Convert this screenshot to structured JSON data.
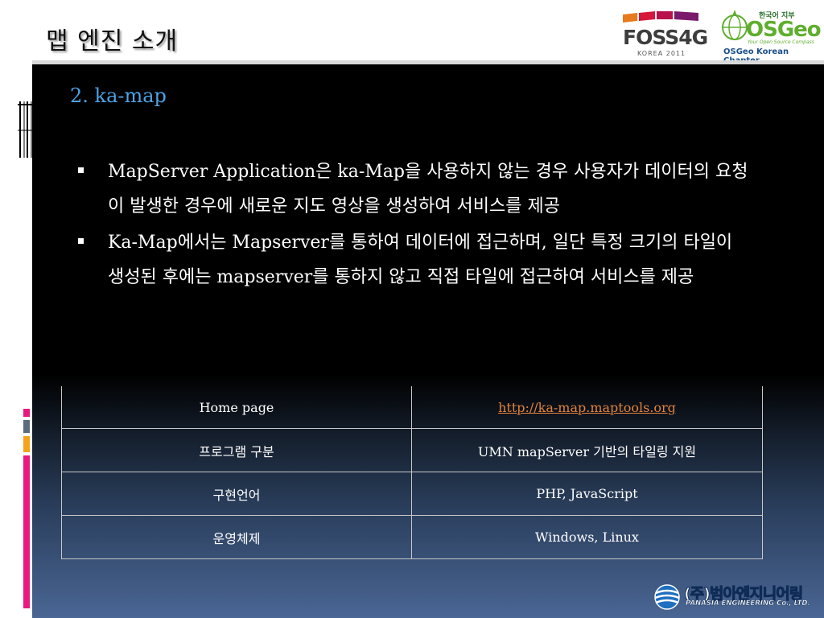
{
  "header": {
    "title": "맵 엔진 소개"
  },
  "logos": {
    "foss4g": {
      "word": "FOSS4G",
      "sub": "KOREA 2011"
    },
    "osgeo": {
      "top": "한국어 지부",
      "word": "OSGeo",
      "tagline": "Your Open Source Compass",
      "chapter": "OSGeo Korean Chapter"
    },
    "panasia": {
      "name": "(주)범아엔지니어링",
      "sub": "PANASIA ENGINEERING Co., LTD."
    }
  },
  "slide": {
    "subtitle": "2. ka-map",
    "bullets": [
      "MapServer Application은 ka-Map을 사용하지 않는 경우 사용자가 데이터의 요청이 발생한 경우에 새로운 지도 영상을 생성하여 서비스를 제공",
      "Ka-Map에서는 Mapserver를 통하여 데이터에 접근하며, 일단 특정 크기의 타일이 생성된 후에는 mapserver를 통하지 않고 직접 타일에 접근하여 서비스를 제공"
    ],
    "table": [
      {
        "label": "Home page",
        "value": "http://ka-map.maptools.org"
      },
      {
        "label": "프로그램 구분",
        "value": "UMN mapServer 기반의 타일링 지원"
      },
      {
        "label": "구현언어",
        "value": "PHP, JavaScript"
      },
      {
        "label": "운영체제",
        "value": "Windows, Linux"
      }
    ]
  },
  "colors": {
    "subtitle": "#4da3e6",
    "link": "#e0823c",
    "accent_magenta": "#e8197f",
    "accent_orange": "#f5a31a",
    "accent_slate": "#5b6b80"
  }
}
